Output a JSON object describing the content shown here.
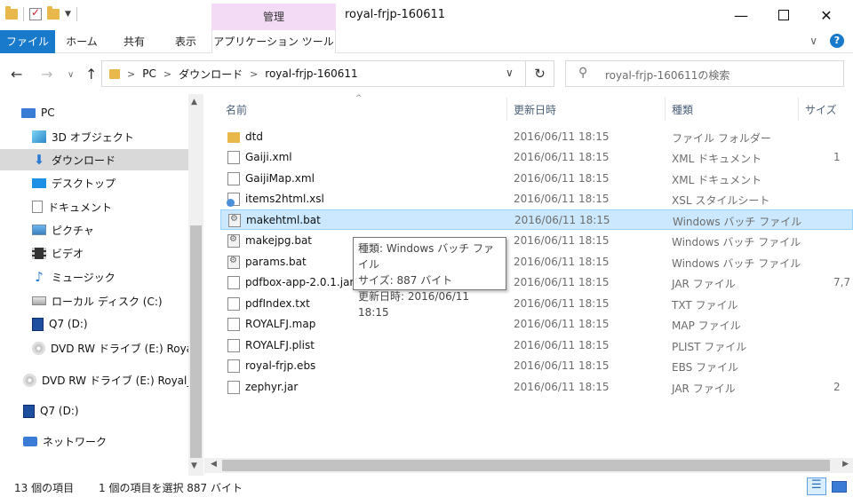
{
  "window": {
    "title": "royal-frjp-160611",
    "manage_label": "管理",
    "minimize": "—",
    "close": "✕"
  },
  "ribbon": {
    "tabs": [
      "ファイル",
      "ホーム",
      "共有",
      "表示",
      "アプリケーション ツール"
    ],
    "help": "?",
    "collapse": "∨"
  },
  "address": {
    "crumbs": [
      "PC",
      "ダウンロード",
      "royal-frjp-160611"
    ],
    "search_placeholder": "royal-frjp-160611の検索"
  },
  "nav_pane": {
    "items": [
      {
        "label": "PC",
        "icon": "pc-icon"
      },
      {
        "label": "3D オブジェクト",
        "icon": "3d-objects-icon"
      },
      {
        "label": "ダウンロード",
        "icon": "download-icon",
        "selected": true
      },
      {
        "label": "デスクトップ",
        "icon": "desktop-icon"
      },
      {
        "label": "ドキュメント",
        "icon": "documents-icon"
      },
      {
        "label": "ピクチャ",
        "icon": "pictures-icon"
      },
      {
        "label": "ビデオ",
        "icon": "videos-icon"
      },
      {
        "label": "ミュージック",
        "icon": "music-icon"
      },
      {
        "label": "ローカル ディスク (C:)",
        "icon": "local-disk-icon"
      },
      {
        "label": "Q7 (D:)",
        "icon": "drive-q7-icon"
      },
      {
        "label": "DVD RW ドライブ (E:) Royal_",
        "icon": "dvd-drive-icon"
      },
      {
        "label": "DVD RW ドライブ (E:) Royal_F",
        "icon": "dvd-drive-icon"
      },
      {
        "label": "Q7 (D:)",
        "icon": "drive-q7-icon"
      },
      {
        "label": "ネットワーク",
        "icon": "network-icon"
      }
    ]
  },
  "columns": {
    "name": "名前",
    "date": "更新日時",
    "type": "種類",
    "size": "サイズ"
  },
  "files": [
    {
      "name": "dtd",
      "date": "2016/06/11 18:15",
      "type": "ファイル フォルダー",
      "size": "",
      "kind": "folder"
    },
    {
      "name": "Gaiji.xml",
      "date": "2016/06/11 18:15",
      "type": "XML ドキュメント",
      "size": "1",
      "kind": "file"
    },
    {
      "name": "GaijiMap.xml",
      "date": "2016/06/11 18:15",
      "type": "XML ドキュメント",
      "size": "",
      "kind": "file"
    },
    {
      "name": "items2html.xsl",
      "date": "2016/06/11 18:15",
      "type": "XSL スタイルシート",
      "size": "",
      "kind": "xsl"
    },
    {
      "name": "makehtml.bat",
      "date": "2016/06/11 18:15",
      "type": "Windows バッチ ファイル",
      "size": "",
      "kind": "bat",
      "selected": true
    },
    {
      "name": "makejpg.bat",
      "date": "2016/06/11 18:15",
      "type": "Windows バッチ ファイル",
      "size": "",
      "kind": "bat"
    },
    {
      "name": "params.bat",
      "date": "2016/06/11 18:15",
      "type": "Windows バッチ ファイル",
      "size": "",
      "kind": "bat"
    },
    {
      "name": "pdfbox-app-2.0.1.jar",
      "date": "2016/06/11 18:15",
      "type": "JAR ファイル",
      "size": "7,7",
      "kind": "file"
    },
    {
      "name": "pdfIndex.txt",
      "date": "2016/06/11 18:15",
      "type": "TXT ファイル",
      "size": "",
      "kind": "file"
    },
    {
      "name": "ROYALFJ.map",
      "date": "2016/06/11 18:15",
      "type": "MAP ファイル",
      "size": "",
      "kind": "file"
    },
    {
      "name": "ROYALFJ.plist",
      "date": "2016/06/11 18:15",
      "type": "PLIST ファイル",
      "size": "",
      "kind": "file"
    },
    {
      "name": "royal-frjp.ebs",
      "date": "2016/06/11 18:15",
      "type": "EBS ファイル",
      "size": "",
      "kind": "file"
    },
    {
      "name": "zephyr.jar",
      "date": "2016/06/11 18:15",
      "type": "JAR ファイル",
      "size": "2",
      "kind": "file"
    }
  ],
  "tooltip": {
    "line1": "種類: Windows バッチ ファイル",
    "line2": "サイズ: 887 バイト",
    "line3": "更新日時: 2016/06/11 18:15"
  },
  "status": {
    "count": "13 個の項目",
    "selection": "1 個の項目を選択 887 バイト"
  }
}
